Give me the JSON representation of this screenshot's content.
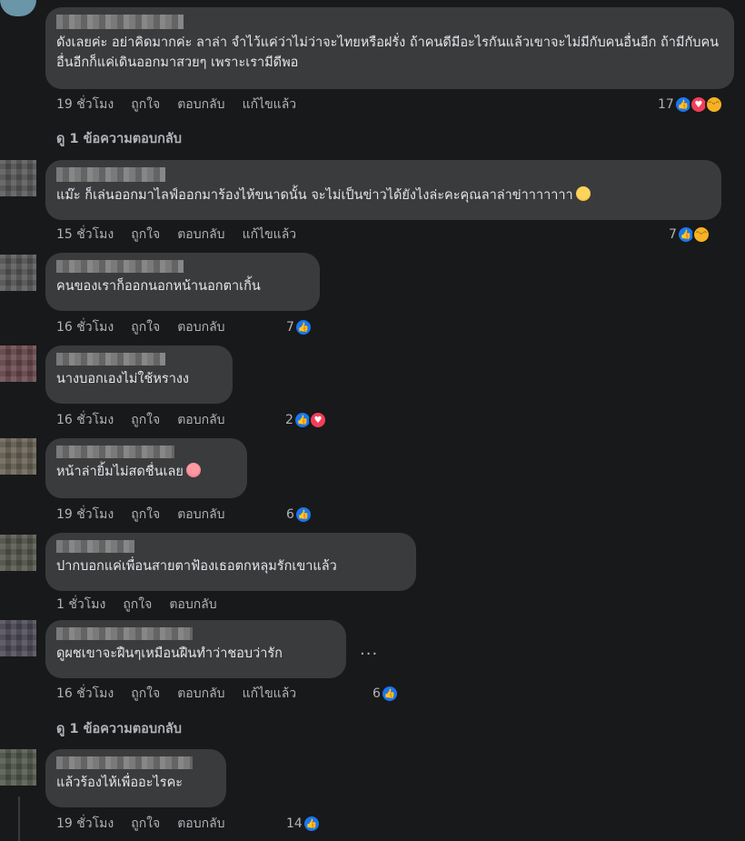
{
  "comments": [
    {
      "text": "ดังเลยค่ะ อย่าคิดมากค่ะ ลาล่า จำไว้แค่ว่าไม่ว่าจะไทยหรือฝรั่ง ถ้าคนดีมีอะไรกันแล้วเขาจะไม่มีกับคนอื่นอีก ถ้ามีกับคนอื่นอีกก็แค่เดินออกมาสวยๆ เพราะเรามีดีพอ",
      "time": "19 ชั่วโมง",
      "like": "ถูกใจ",
      "reply": "ตอบกลับ",
      "edited": "แก้ไขแล้ว",
      "reaction_count": "17",
      "reactions": [
        "like-icon",
        "love-icon",
        "haha-icon"
      ],
      "view_replies": "ดู 1 ข้อความตอบกลับ"
    },
    {
      "text": "แม๊ะ ก็เล่นออกมาไลฟ์ออกมาร้องไห้ขนาดนั้น จะไม่เป็นข่าวได้ยังไงล่ะคะคุณลาล่าข่าาาาาาา",
      "time": "15 ชั่วโมง",
      "like": "ถูกใจ",
      "reply": "ตอบกลับ",
      "edited": "แก้ไขแล้ว",
      "reaction_count": "7",
      "reactions": [
        "like-icon",
        "haha-icon"
      ]
    },
    {
      "text": "คนของเราก็ออกนอกหน้านอกตาเกิ้น",
      "time": "16 ชั่วโมง",
      "like": "ถูกใจ",
      "reply": "ตอบกลับ",
      "reaction_count": "7",
      "reactions": [
        "like-icon"
      ]
    },
    {
      "text": "นางบอกเองไม่ใช้หรางง",
      "time": "16 ชั่วโมง",
      "like": "ถูกใจ",
      "reply": "ตอบกลับ",
      "reaction_count": "2",
      "reactions": [
        "like-icon",
        "love-icon"
      ]
    },
    {
      "text": "หน้าล่ายิ้มไม่สดชื่นเลย",
      "time": "19 ชั่วโมง",
      "like": "ถูกใจ",
      "reply": "ตอบกลับ",
      "reaction_count": "6",
      "reactions": [
        "like-icon"
      ]
    },
    {
      "text": "ปากบอกแค่เพื่อนสายตาฟ้องเธอตกหลุมรักเขาแล้ว",
      "time": "1 ชั่วโมง",
      "like": "ถูกใจ",
      "reply": "ตอบกลับ"
    },
    {
      "text": "ดูผชเขาจะฝืนๆเหมือนฝืนทำว่าชอบว่ารัก",
      "time": "16 ชั่วโมง",
      "like": "ถูกใจ",
      "reply": "ตอบกลับ",
      "edited": "แก้ไขแล้ว",
      "reaction_count": "6",
      "reactions": [
        "like-icon"
      ],
      "view_replies": "ดู 1 ข้อความตอบกลับ",
      "more": "..."
    },
    {
      "text": "แล้วร้องไห้เพื่ออะไรคะ",
      "time": "19 ชั่วโมง",
      "like": "ถูกใจ",
      "reply": "ตอบกลับ",
      "reaction_count": "14",
      "reactions": [
        "like-icon"
      ]
    }
  ]
}
